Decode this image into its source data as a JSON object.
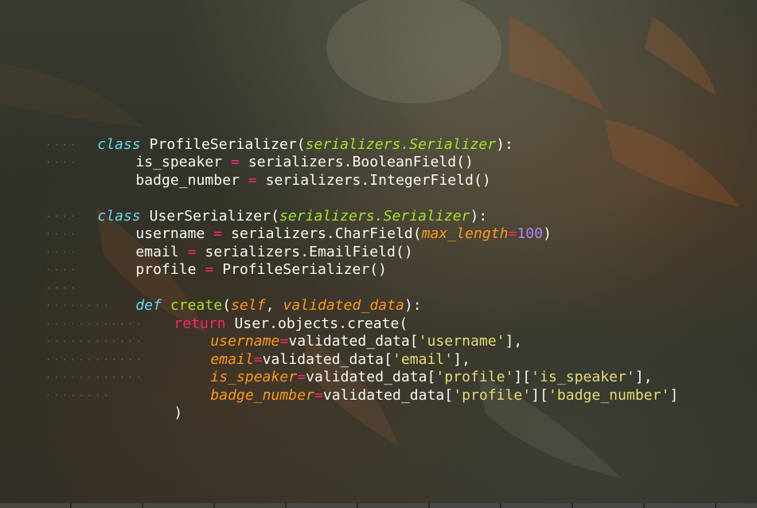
{
  "theme": {
    "keyword_color": "#66d9ef",
    "operator_color": "#f92672",
    "function_color": "#a6e22e",
    "argument_color": "#fd971f",
    "number_color": "#ae81ff",
    "string_color": "#e6db74",
    "text_color": "#f8f8f2"
  },
  "code": {
    "line1": {
      "kw": "class",
      "name": "ProfileSerializer",
      "open": "(",
      "base": "serializers.Serializer",
      "close": "):"
    },
    "line2": {
      "name": "is_speaker",
      "eq": "=",
      "rest": "serializers.BooleanField()"
    },
    "line3": {
      "name": "badge_number",
      "eq": "=",
      "rest": "serializers.IntegerField()"
    },
    "line5": {
      "kw": "class",
      "name": "UserSerializer",
      "open": "(",
      "base": "serializers.Serializer",
      "close": "):"
    },
    "line6": {
      "name": "username",
      "eq": "=",
      "call": "serializers.CharField(",
      "arg": "max_length",
      "argeq": "=",
      "num": "100",
      "close": ")"
    },
    "line7": {
      "name": "email",
      "eq": "=",
      "rest": "serializers.EmailField()"
    },
    "line8": {
      "name": "profile",
      "eq": "=",
      "rest": "ProfileSerializer()"
    },
    "line10": {
      "kw": "def",
      "fn": "create",
      "open": "(",
      "self": "self",
      "comma": ", ",
      "arg": "validated_data",
      "close": "):"
    },
    "line11": {
      "kw": "return",
      "rest": "User.objects.create("
    },
    "line12": {
      "arg": "username",
      "eq": "=",
      "pre": "validated_data[",
      "key": "'username'",
      "post": "],"
    },
    "line13": {
      "arg": "email",
      "eq": "=",
      "pre": "validated_data[",
      "key": "'email'",
      "post": "],"
    },
    "line14": {
      "arg": "is_speaker",
      "eq": "=",
      "pre": "validated_data[",
      "key": "'profile'",
      "mid": "][",
      "key2": "'is_speaker'",
      "post": "],"
    },
    "line15": {
      "arg": "badge_number",
      "eq": "=",
      "pre": "validated_data[",
      "key": "'profile'",
      "mid": "][",
      "key2": "'badge_number'",
      "post": "]"
    },
    "line16": {
      "rest": ")"
    }
  },
  "guides": {
    "g1": "····",
    "g2": "········",
    "g3": "············",
    "g4": "··········"
  }
}
